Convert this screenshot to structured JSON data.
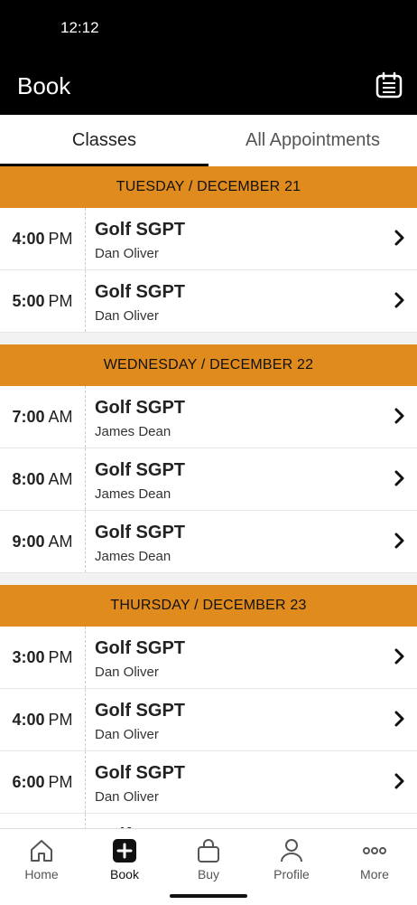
{
  "status": {
    "time": "12:12"
  },
  "header": {
    "title": "Book",
    "calendar_icon": "calendar-icon"
  },
  "tabs": [
    {
      "label": "Classes",
      "active": true
    },
    {
      "label": "All Appointments",
      "active": false
    }
  ],
  "days": [
    {
      "header": "TUESDAY / DECEMBER 21",
      "sessions": [
        {
          "hour": "4:00",
          "ampm": "PM",
          "title": "Golf SGPT",
          "instructor": "Dan Oliver"
        },
        {
          "hour": "5:00",
          "ampm": "PM",
          "title": "Golf SGPT",
          "instructor": "Dan Oliver"
        }
      ]
    },
    {
      "header": "WEDNESDAY / DECEMBER 22",
      "sessions": [
        {
          "hour": "7:00",
          "ampm": "AM",
          "title": "Golf SGPT",
          "instructor": "James Dean"
        },
        {
          "hour": "8:00",
          "ampm": "AM",
          "title": "Golf SGPT",
          "instructor": "James Dean"
        },
        {
          "hour": "9:00",
          "ampm": "AM",
          "title": "Golf SGPT",
          "instructor": "James Dean"
        }
      ]
    },
    {
      "header": "THURSDAY / DECEMBER 23",
      "sessions": [
        {
          "hour": "3:00",
          "ampm": "PM",
          "title": "Golf SGPT",
          "instructor": "Dan Oliver"
        },
        {
          "hour": "4:00",
          "ampm": "PM",
          "title": "Golf SGPT",
          "instructor": "Dan Oliver"
        },
        {
          "hour": "6:00",
          "ampm": "PM",
          "title": "Golf SGPT",
          "instructor": "Dan Oliver"
        },
        {
          "hour": "",
          "ampm": "",
          "title": "Golf SGPT",
          "instructor": ""
        }
      ]
    }
  ],
  "nav": [
    {
      "label": "Home",
      "icon": "home-icon",
      "active": false
    },
    {
      "label": "Book",
      "icon": "plus-icon",
      "active": true
    },
    {
      "label": "Buy",
      "icon": "bag-icon",
      "active": false
    },
    {
      "label": "Profile",
      "icon": "person-icon",
      "active": false
    },
    {
      "label": "More",
      "icon": "ellipsis-icon",
      "active": false
    }
  ],
  "colors": {
    "accent": "#e08b1e",
    "header_bg": "#000000"
  }
}
